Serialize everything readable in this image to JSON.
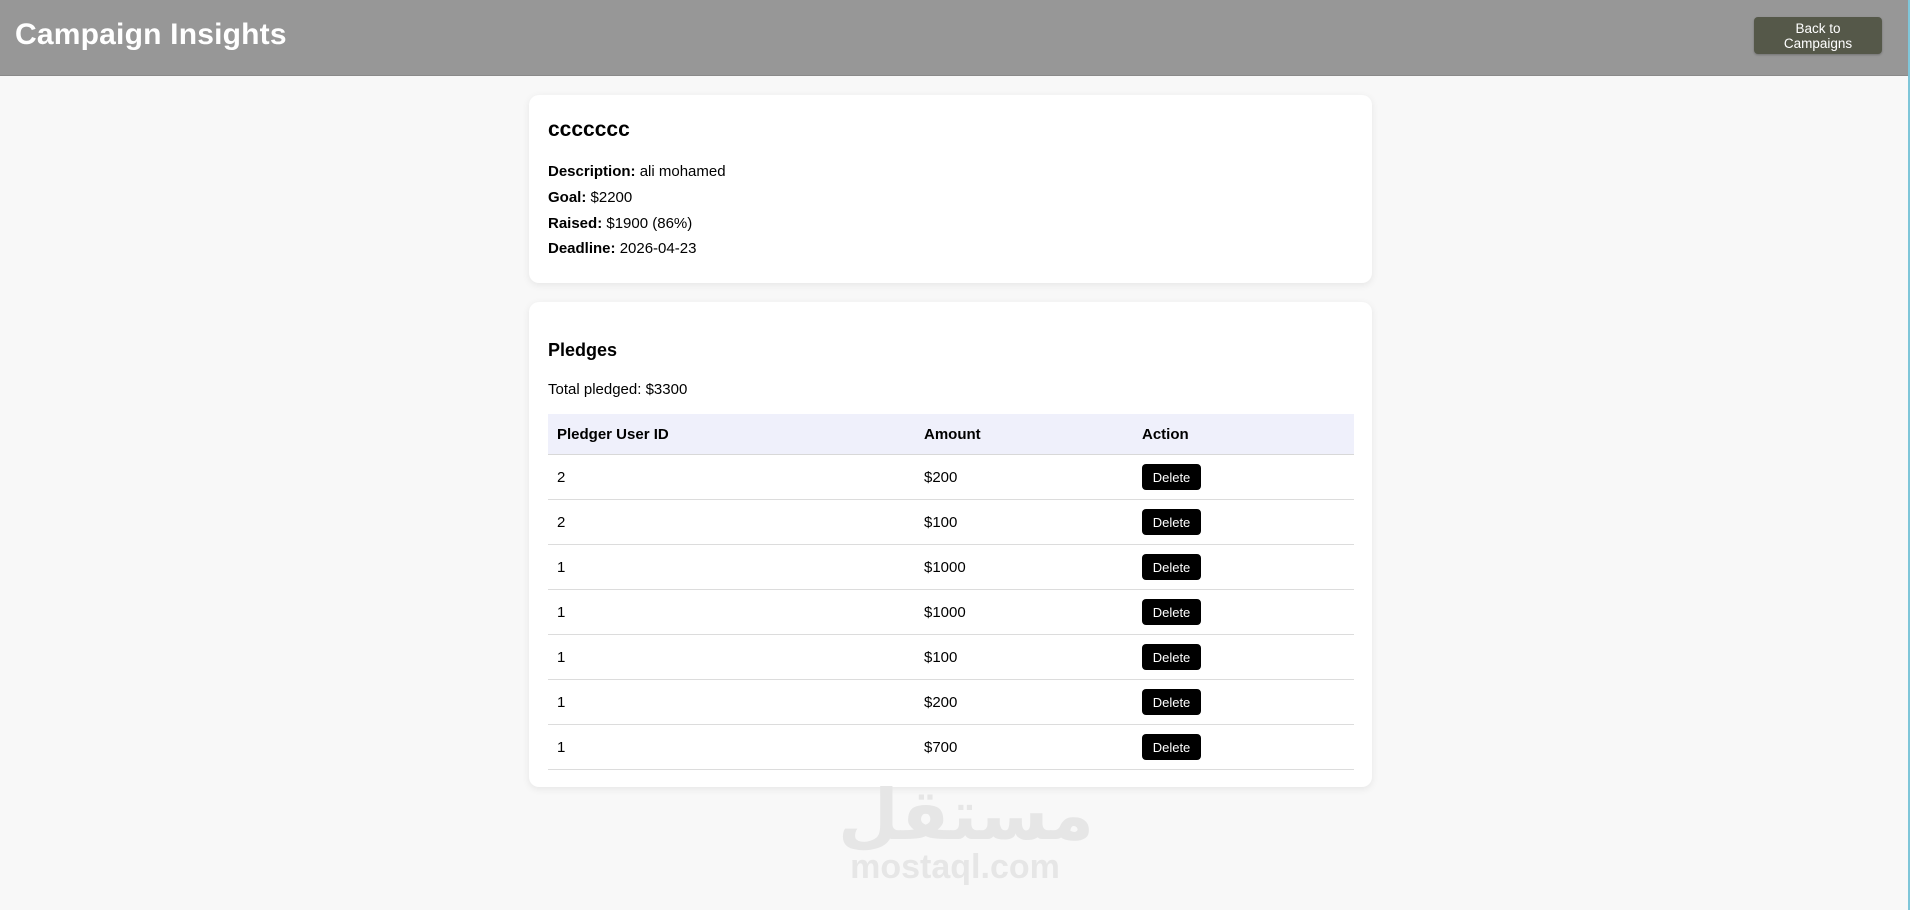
{
  "header": {
    "title": "Campaign Insights",
    "back_label": "Back to Campaigns"
  },
  "campaign": {
    "name": "ccccccc",
    "description_label": "Description:",
    "description": "ali mohamed",
    "goal_label": "Goal:",
    "goal": "$2200",
    "raised_label": "Raised:",
    "raised": "$1900 (86%)",
    "deadline_label": "Deadline:",
    "deadline": "2026-04-23"
  },
  "pledges": {
    "title": "Pledges",
    "total": "Total pledged: $3300",
    "columns": [
      "Pledger User ID",
      "Amount",
      "Action"
    ],
    "delete_label": "Delete",
    "rows": [
      {
        "user_id": "2",
        "amount": "$200"
      },
      {
        "user_id": "2",
        "amount": "$100"
      },
      {
        "user_id": "1",
        "amount": "$1000"
      },
      {
        "user_id": "1",
        "amount": "$1000"
      },
      {
        "user_id": "1",
        "amount": "$100"
      },
      {
        "user_id": "1",
        "amount": "$200"
      },
      {
        "user_id": "1",
        "amount": "$700"
      }
    ]
  },
  "watermark": {
    "arabic": "مستقل",
    "latin": "mostaql.com"
  },
  "colors": {
    "header_bg": "#979797",
    "back_button_bg": "#555849",
    "table_header_bg": "#eff0fb",
    "delete_button_bg": "#000000"
  }
}
